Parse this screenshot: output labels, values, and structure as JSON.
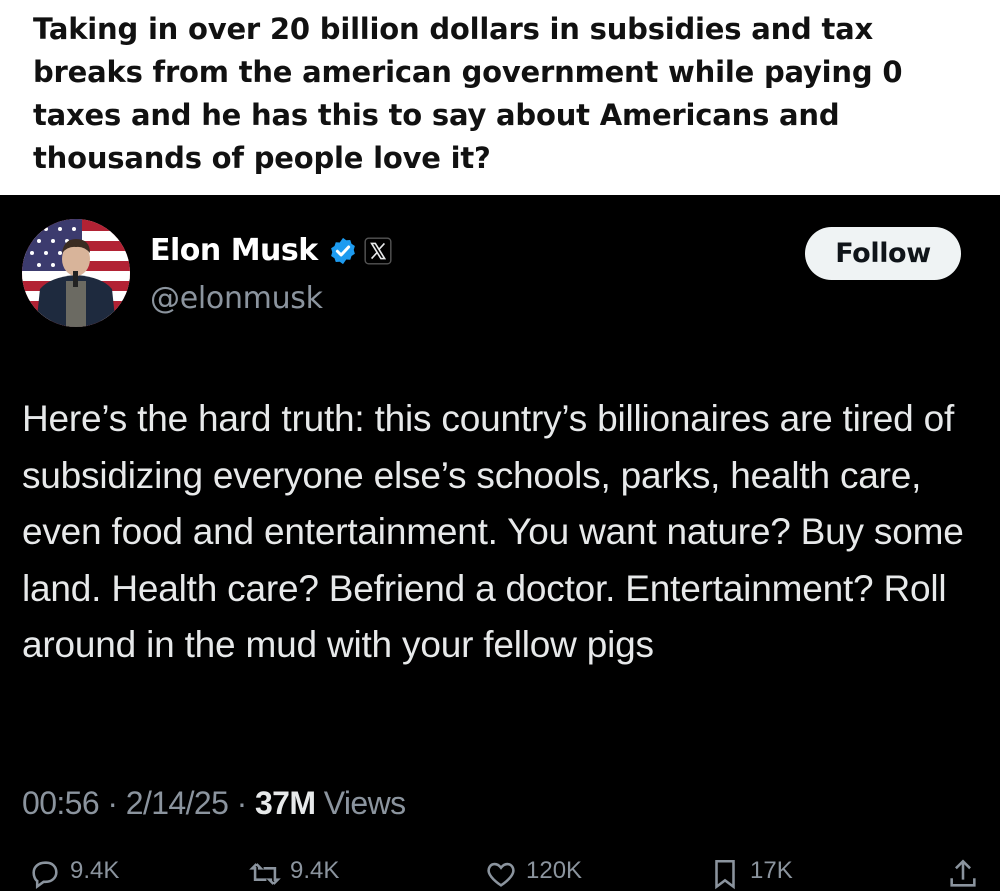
{
  "caption": "Taking in over 20 billion dollars in subsidies and tax breaks from the american government while paying 0 taxes and he has this to say about Americans and thousands of people love it?",
  "tweet": {
    "author_name": "Elon Musk",
    "handle": "@elonmusk",
    "follow_label": "Follow",
    "text": "Here’s the hard truth: this country’s billionaires are tired of subsidizing everyone else’s schools, parks, health care, even food and entertainment. You want nature? Buy some land. Health care? Befriend a doctor. Entertainment? Roll around in the mud with your fellow pigs",
    "time": "00:56",
    "date": "2/14/25",
    "views_count": "37M",
    "views_label": "Views",
    "separator": "·",
    "actions": {
      "reply_count": "9.4K",
      "repost_count": "9.4K",
      "like_count": "120K",
      "bookmark_count": "17K"
    }
  },
  "colors": {
    "background": "#000000",
    "text_primary": "#e7e9ea",
    "text_secondary": "#8b949e",
    "verified": "#1d9bf0",
    "follow_bg": "#eff3f4"
  },
  "icons": [
    "verified-badge-icon",
    "x-logo-icon",
    "reply-icon",
    "repost-icon",
    "like-icon",
    "bookmark-icon",
    "share-icon"
  ]
}
